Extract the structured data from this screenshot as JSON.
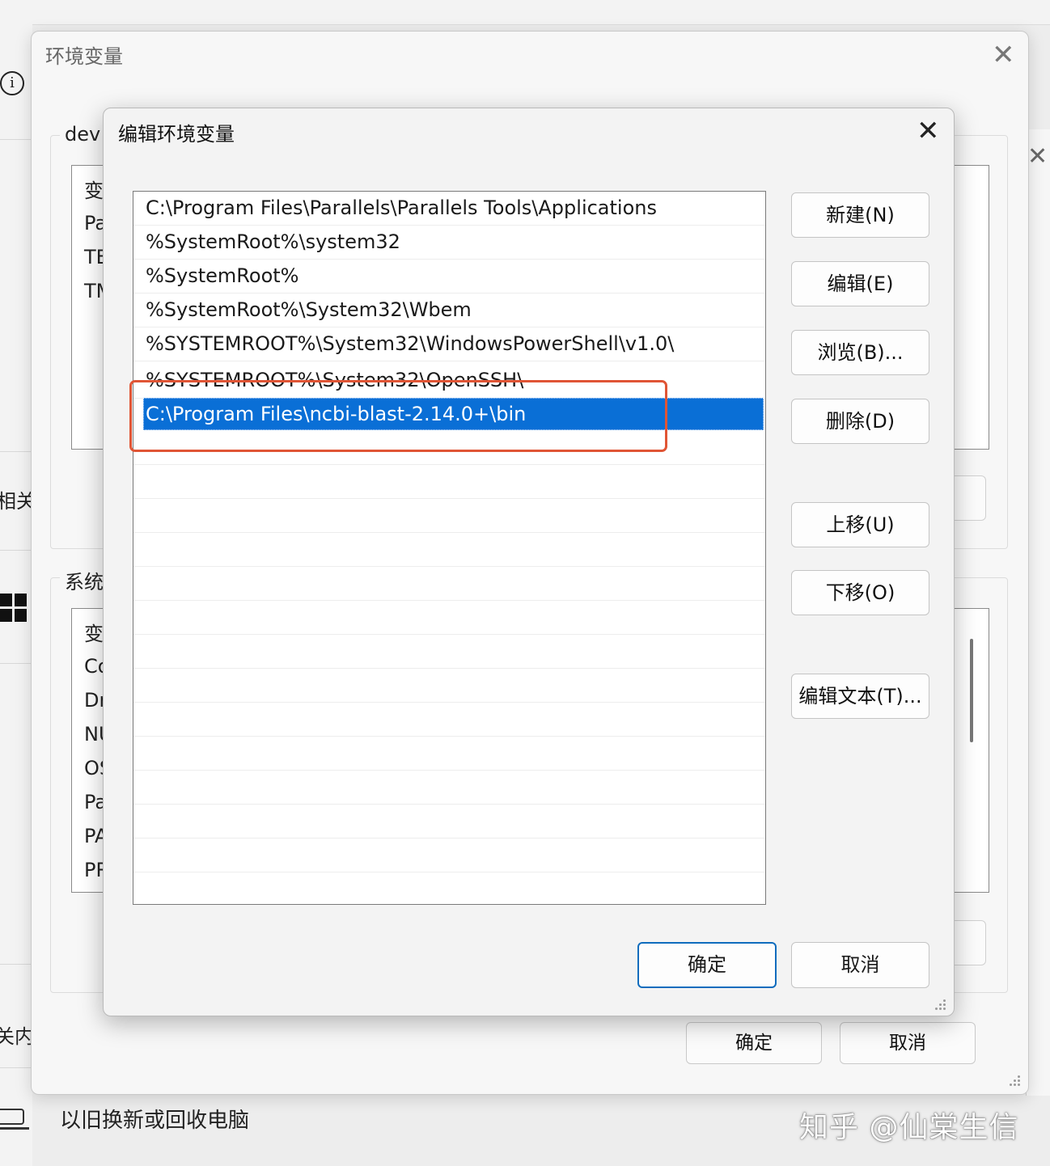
{
  "background": {
    "left_partial_labels": [
      "相关",
      "关内"
    ],
    "bottom_item": "以旧换新或回收电脑",
    "watermark": "知乎 @仙棠生信"
  },
  "env_window": {
    "title": "环境变量",
    "user_group_label": "dev",
    "user_rows": [
      "变",
      "Pa",
      "TE",
      "TM"
    ],
    "system_group_label": "系统",
    "system_rows": [
      "变",
      "Co",
      "Dr",
      "NU",
      "OS",
      "Pa",
      "PA",
      "PR"
    ],
    "ok_label": "确定",
    "cancel_label": "取消"
  },
  "dialog": {
    "title": "编辑环境变量",
    "paths": [
      "C:\\Program Files\\Parallels\\Parallels Tools\\Applications",
      "%SystemRoot%\\system32",
      "%SystemRoot%",
      "%SystemRoot%\\System32\\Wbem",
      "%SYSTEMROOT%\\System32\\WindowsPowerShell\\v1.0\\",
      "%SYSTEMROOT%\\System32\\OpenSSH\\",
      "C:\\Program Files\\ncbi-blast-2.14.0+\\bin"
    ],
    "selected_index": 6,
    "buttons": {
      "new": "新建(N)",
      "edit": "编辑(E)",
      "browse": "浏览(B)...",
      "delete": "删除(D)",
      "move_up": "上移(U)",
      "move_down": "下移(O)",
      "edit_text": "编辑文本(T)..."
    },
    "ok_label": "确定",
    "cancel_label": "取消"
  },
  "colors": {
    "selection": "#0a6fd6",
    "highlight_box": "#e05535",
    "primary_border": "#0f6cbd"
  }
}
